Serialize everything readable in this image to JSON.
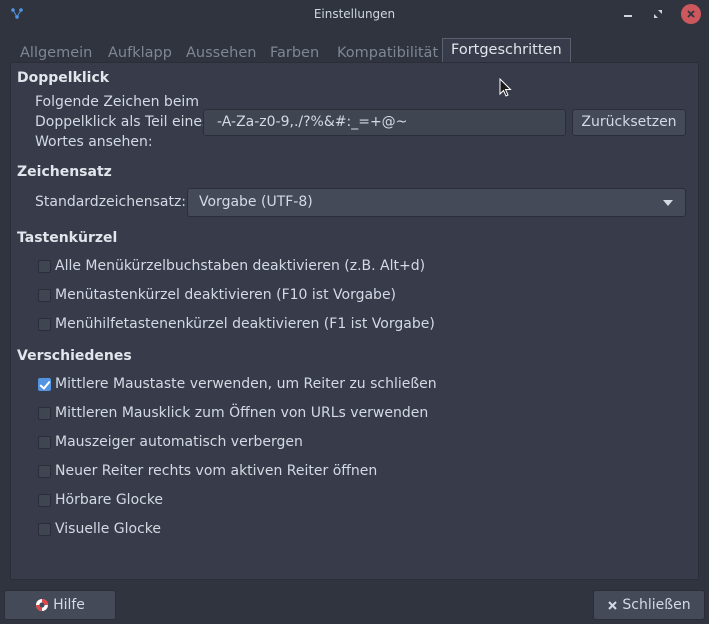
{
  "window": {
    "title": "Einstellungen"
  },
  "tabs": [
    {
      "label": "Allgemein"
    },
    {
      "label": "Aufklapp"
    },
    {
      "label": "Aussehen"
    },
    {
      "label": "Farben"
    },
    {
      "label": "Kompatibilität"
    },
    {
      "label": "Fortgeschritten",
      "active": true
    }
  ],
  "doubleclick": {
    "heading": "Doppelklick",
    "label_line1": "Folgende Zeichen beim",
    "label_line2": "Doppelklick als Teil eines",
    "label_line3": "Wortes ansehen:",
    "value": "-A-Za-z0-9,./?%&#:_=+@~",
    "reset_label": "Zurücksetzen"
  },
  "charset": {
    "heading": "Zeichensatz",
    "label": "Standardzeichensatz:",
    "selected": "Vorgabe (UTF-8)"
  },
  "shortcuts": {
    "heading": "Tastenkürzel",
    "options": [
      {
        "label": "Alle Menükürzelbuchstaben deaktivieren (z.B. Alt+d)",
        "checked": false
      },
      {
        "label": "Menütastenkürzel deaktivieren (F10 ist Vorgabe)",
        "checked": false
      },
      {
        "label": "Menühilfetastenenkürzel deaktivieren (F1 ist Vorgabe)",
        "checked": false
      }
    ]
  },
  "misc": {
    "heading": "Verschiedenes",
    "options": [
      {
        "label": "Mittlere Maustaste verwenden, um Reiter zu schließen",
        "checked": true
      },
      {
        "label": "Mittleren Mausklick zum Öffnen von URLs verwenden",
        "checked": false
      },
      {
        "label": "Mauszeiger automatisch verbergen",
        "checked": false
      },
      {
        "label": "Neuer Reiter rechts vom aktiven Reiter öffnen",
        "checked": false
      },
      {
        "label": "Hörbare Glocke",
        "checked": false
      },
      {
        "label": "Visuelle Glocke",
        "checked": false
      }
    ]
  },
  "footer": {
    "help_label": "Hilfe",
    "close_label": "Schließen"
  },
  "colors": {
    "background": "#2f343f",
    "panel": "#383c4a",
    "accent": "#5294e2",
    "close_button": "#cc575d"
  }
}
